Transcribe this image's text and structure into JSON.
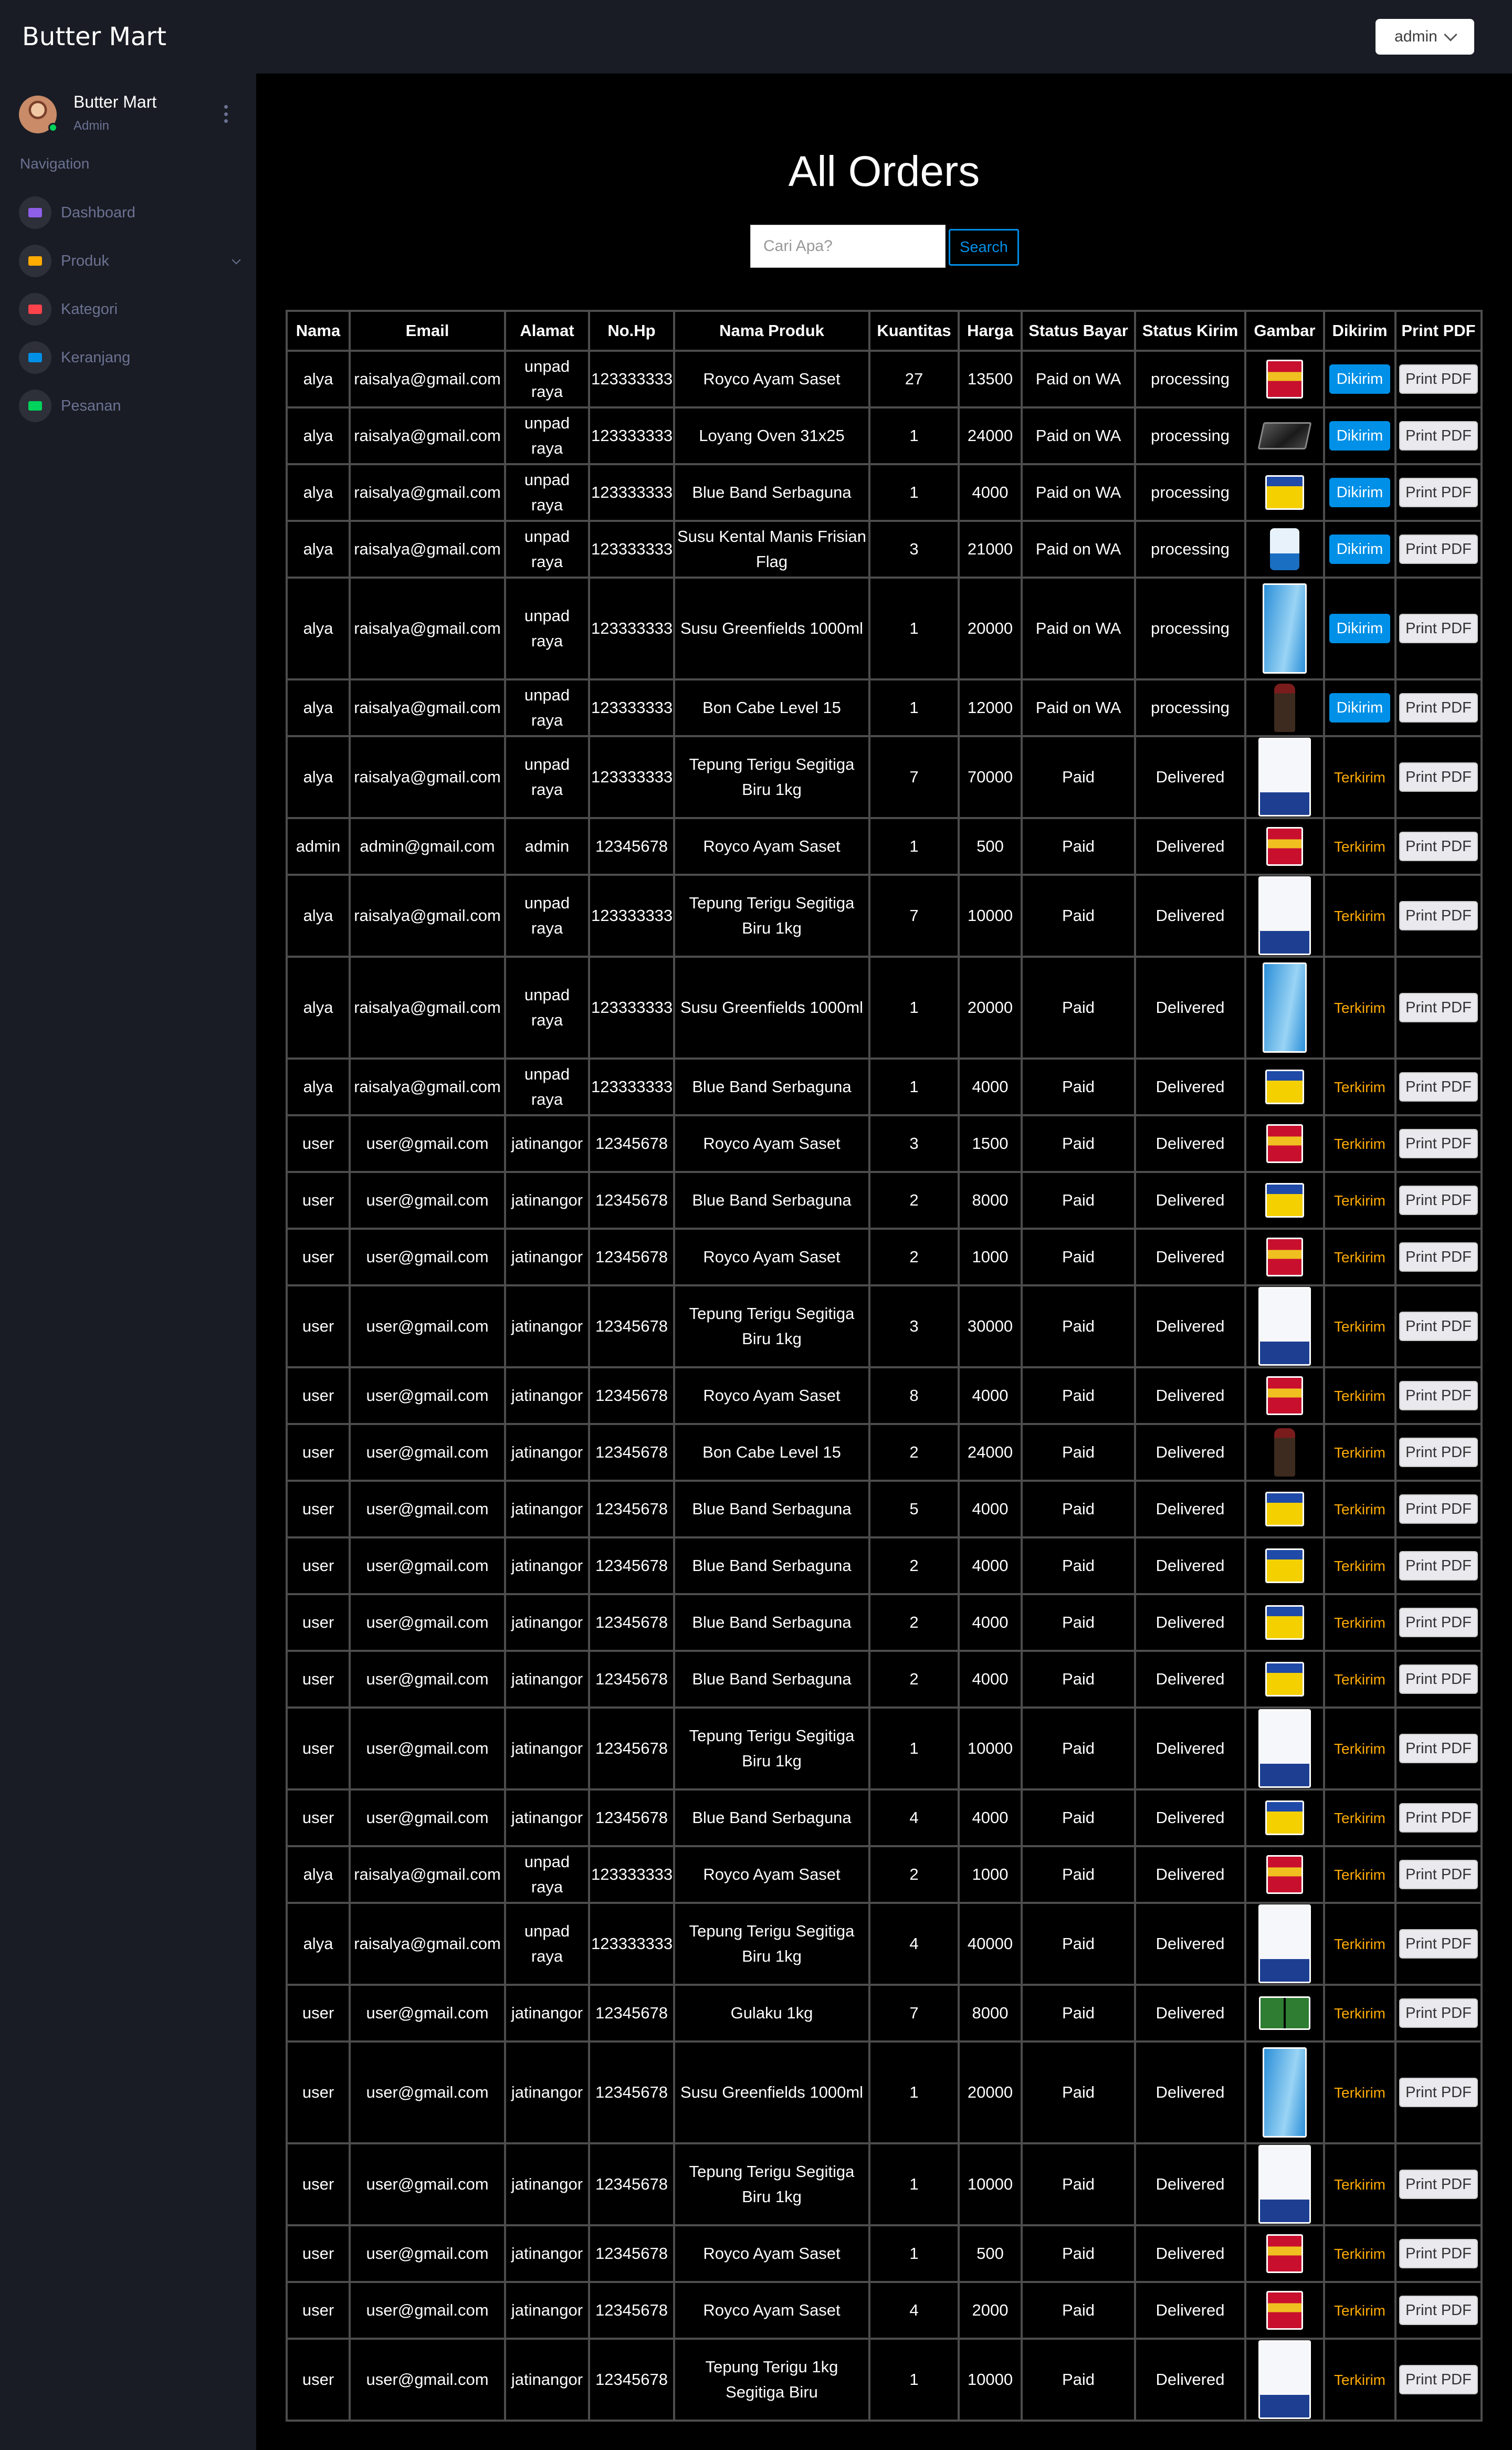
{
  "app": {
    "brand": "Butter Mart",
    "admin_dropdown": "admin"
  },
  "sidebar": {
    "profile_name": "Butter Mart",
    "profile_role": "Admin",
    "nav_heading": "Navigation",
    "items": [
      {
        "label": "Dashboard",
        "icon": "speedometer-icon",
        "color": "#8f5fe8"
      },
      {
        "label": "Produk",
        "icon": "laptop-icon",
        "color": "#ffab00"
      },
      {
        "label": "Kategori",
        "icon": "playlist-icon",
        "color": "#fc424a"
      },
      {
        "label": "Keranjang",
        "icon": "chart-bar-icon",
        "color": "#0090e7"
      },
      {
        "label": "Pesanan",
        "icon": "table-icon",
        "color": "#00d25b"
      }
    ]
  },
  "main": {
    "title": "All Orders",
    "search_placeholder": "Cari Apa?",
    "search_button": "Search",
    "columns": [
      "Nama",
      "Email",
      "Alamat",
      "No.Hp",
      "Nama Produk",
      "Kuantitas",
      "Harga",
      "Status Bayar",
      "Status Kirim",
      "Gambar",
      "Dikirim",
      "Print PDF"
    ],
    "dikirim_label": "Dikirim",
    "terkirim_label": "Terkirim",
    "print_label": "Print PDF"
  },
  "orders": [
    {
      "nama": "alya",
      "email": "raisalya@gmail.com",
      "alamat": "unpad raya",
      "hp": "123333333",
      "produk": "Royco Ayam Saset",
      "qty": "27",
      "harga": "13500",
      "bayar": "Paid on WA",
      "kirim": "processing",
      "img": "royco",
      "dikirim": true
    },
    {
      "nama": "alya",
      "email": "raisalya@gmail.com",
      "alamat": "unpad raya",
      "hp": "123333333",
      "produk": "Loyang Oven 31x25",
      "qty": "1",
      "harga": "24000",
      "bayar": "Paid on WA",
      "kirim": "processing",
      "img": "loyang",
      "dikirim": true
    },
    {
      "nama": "alya",
      "email": "raisalya@gmail.com",
      "alamat": "unpad raya",
      "hp": "123333333",
      "produk": "Blue Band Serbaguna",
      "qty": "1",
      "harga": "4000",
      "bayar": "Paid on WA",
      "kirim": "processing",
      "img": "blueband",
      "dikirim": true
    },
    {
      "nama": "alya",
      "email": "raisalya@gmail.com",
      "alamat": "unpad raya",
      "hp": "123333333",
      "produk": "Susu Kental Manis Frisian Flag",
      "qty": "3",
      "harga": "21000",
      "bayar": "Paid on WA",
      "kirim": "processing",
      "img": "frisian",
      "dikirim": true
    },
    {
      "nama": "alya",
      "email": "raisalya@gmail.com",
      "alamat": "unpad raya",
      "hp": "123333333",
      "produk": "Susu Greenfields 1000ml",
      "qty": "1",
      "harga": "20000",
      "bayar": "Paid on WA",
      "kirim": "processing",
      "img": "green",
      "dikirim": true
    },
    {
      "nama": "alya",
      "email": "raisalya@gmail.com",
      "alamat": "unpad raya",
      "hp": "123333333",
      "produk": "Bon Cabe Level 15",
      "qty": "1",
      "harga": "12000",
      "bayar": "Paid on WA",
      "kirim": "processing",
      "img": "boncabe",
      "dikirim": true
    },
    {
      "nama": "alya",
      "email": "raisalya@gmail.com",
      "alamat": "unpad raya",
      "hp": "123333333",
      "produk": "Tepung Terigu Segitiga Biru 1kg",
      "qty": "7",
      "harga": "70000",
      "bayar": "Paid",
      "kirim": "Delivered",
      "img": "tepung",
      "dikirim": false
    },
    {
      "nama": "admin",
      "email": "admin@gmail.com",
      "alamat": "admin",
      "hp": "12345678",
      "produk": "Royco Ayam Saset",
      "qty": "1",
      "harga": "500",
      "bayar": "Paid",
      "kirim": "Delivered",
      "img": "royco",
      "dikirim": false
    },
    {
      "nama": "alya",
      "email": "raisalya@gmail.com",
      "alamat": "unpad raya",
      "hp": "123333333",
      "produk": "Tepung Terigu Segitiga Biru 1kg",
      "qty": "7",
      "harga": "10000",
      "bayar": "Paid",
      "kirim": "Delivered",
      "img": "tepung",
      "dikirim": false
    },
    {
      "nama": "alya",
      "email": "raisalya@gmail.com",
      "alamat": "unpad raya",
      "hp": "123333333",
      "produk": "Susu Greenfields 1000ml",
      "qty": "1",
      "harga": "20000",
      "bayar": "Paid",
      "kirim": "Delivered",
      "img": "green",
      "dikirim": false
    },
    {
      "nama": "alya",
      "email": "raisalya@gmail.com",
      "alamat": "unpad raya",
      "hp": "123333333",
      "produk": "Blue Band Serbaguna",
      "qty": "1",
      "harga": "4000",
      "bayar": "Paid",
      "kirim": "Delivered",
      "img": "blueband",
      "dikirim": false
    },
    {
      "nama": "user",
      "email": "user@gmail.com",
      "alamat": "jatinangor",
      "hp": "12345678",
      "produk": "Royco Ayam Saset",
      "qty": "3",
      "harga": "1500",
      "bayar": "Paid",
      "kirim": "Delivered",
      "img": "royco",
      "dikirim": false
    },
    {
      "nama": "user",
      "email": "user@gmail.com",
      "alamat": "jatinangor",
      "hp": "12345678",
      "produk": "Blue Band Serbaguna",
      "qty": "2",
      "harga": "8000",
      "bayar": "Paid",
      "kirim": "Delivered",
      "img": "blueband",
      "dikirim": false
    },
    {
      "nama": "user",
      "email": "user@gmail.com",
      "alamat": "jatinangor",
      "hp": "12345678",
      "produk": "Royco Ayam Saset",
      "qty": "2",
      "harga": "1000",
      "bayar": "Paid",
      "kirim": "Delivered",
      "img": "royco",
      "dikirim": false
    },
    {
      "nama": "user",
      "email": "user@gmail.com",
      "alamat": "jatinangor",
      "hp": "12345678",
      "produk": "Tepung Terigu Segitiga Biru 1kg",
      "qty": "3",
      "harga": "30000",
      "bayar": "Paid",
      "kirim": "Delivered",
      "img": "tepung",
      "dikirim": false
    },
    {
      "nama": "user",
      "email": "user@gmail.com",
      "alamat": "jatinangor",
      "hp": "12345678",
      "produk": "Royco Ayam Saset",
      "qty": "8",
      "harga": "4000",
      "bayar": "Paid",
      "kirim": "Delivered",
      "img": "royco",
      "dikirim": false
    },
    {
      "nama": "user",
      "email": "user@gmail.com",
      "alamat": "jatinangor",
      "hp": "12345678",
      "produk": "Bon Cabe Level 15",
      "qty": "2",
      "harga": "24000",
      "bayar": "Paid",
      "kirim": "Delivered",
      "img": "boncabe",
      "dikirim": false
    },
    {
      "nama": "user",
      "email": "user@gmail.com",
      "alamat": "jatinangor",
      "hp": "12345678",
      "produk": "Blue Band Serbaguna",
      "qty": "5",
      "harga": "4000",
      "bayar": "Paid",
      "kirim": "Delivered",
      "img": "blueband",
      "dikirim": false
    },
    {
      "nama": "user",
      "email": "user@gmail.com",
      "alamat": "jatinangor",
      "hp": "12345678",
      "produk": "Blue Band Serbaguna",
      "qty": "2",
      "harga": "4000",
      "bayar": "Paid",
      "kirim": "Delivered",
      "img": "blueband",
      "dikirim": false
    },
    {
      "nama": "user",
      "email": "user@gmail.com",
      "alamat": "jatinangor",
      "hp": "12345678",
      "produk": "Blue Band Serbaguna",
      "qty": "2",
      "harga": "4000",
      "bayar": "Paid",
      "kirim": "Delivered",
      "img": "blueband",
      "dikirim": false
    },
    {
      "nama": "user",
      "email": "user@gmail.com",
      "alamat": "jatinangor",
      "hp": "12345678",
      "produk": "Blue Band Serbaguna",
      "qty": "2",
      "harga": "4000",
      "bayar": "Paid",
      "kirim": "Delivered",
      "img": "blueband",
      "dikirim": false
    },
    {
      "nama": "user",
      "email": "user@gmail.com",
      "alamat": "jatinangor",
      "hp": "12345678",
      "produk": "Tepung Terigu Segitiga Biru 1kg",
      "qty": "1",
      "harga": "10000",
      "bayar": "Paid",
      "kirim": "Delivered",
      "img": "tepung",
      "dikirim": false
    },
    {
      "nama": "user",
      "email": "user@gmail.com",
      "alamat": "jatinangor",
      "hp": "12345678",
      "produk": "Blue Band Serbaguna",
      "qty": "4",
      "harga": "4000",
      "bayar": "Paid",
      "kirim": "Delivered",
      "img": "blueband",
      "dikirim": false
    },
    {
      "nama": "alya",
      "email": "raisalya@gmail.com",
      "alamat": "unpad raya",
      "hp": "123333333",
      "produk": "Royco Ayam Saset",
      "qty": "2",
      "harga": "1000",
      "bayar": "Paid",
      "kirim": "Delivered",
      "img": "royco",
      "dikirim": false
    },
    {
      "nama": "alya",
      "email": "raisalya@gmail.com",
      "alamat": "unpad raya",
      "hp": "123333333",
      "produk": "Tepung Terigu Segitiga Biru 1kg",
      "qty": "4",
      "harga": "40000",
      "bayar": "Paid",
      "kirim": "Delivered",
      "img": "tepung",
      "dikirim": false
    },
    {
      "nama": "user",
      "email": "user@gmail.com",
      "alamat": "jatinangor",
      "hp": "12345678",
      "produk": "Gulaku 1kg",
      "qty": "7",
      "harga": "8000",
      "bayar": "Paid",
      "kirim": "Delivered",
      "img": "gulaku",
      "dikirim": false
    },
    {
      "nama": "user",
      "email": "user@gmail.com",
      "alamat": "jatinangor",
      "hp": "12345678",
      "produk": "Susu Greenfields 1000ml",
      "qty": "1",
      "harga": "20000",
      "bayar": "Paid",
      "kirim": "Delivered",
      "img": "green",
      "dikirim": false
    },
    {
      "nama": "user",
      "email": "user@gmail.com",
      "alamat": "jatinangor",
      "hp": "12345678",
      "produk": "Tepung Terigu Segitiga Biru 1kg",
      "qty": "1",
      "harga": "10000",
      "bayar": "Paid",
      "kirim": "Delivered",
      "img": "tepung",
      "dikirim": false
    },
    {
      "nama": "user",
      "email": "user@gmail.com",
      "alamat": "jatinangor",
      "hp": "12345678",
      "produk": "Royco Ayam Saset",
      "qty": "1",
      "harga": "500",
      "bayar": "Paid",
      "kirim": "Delivered",
      "img": "royco",
      "dikirim": false
    },
    {
      "nama": "user",
      "email": "user@gmail.com",
      "alamat": "jatinangor",
      "hp": "12345678",
      "produk": "Royco Ayam Saset",
      "qty": "4",
      "harga": "2000",
      "bayar": "Paid",
      "kirim": "Delivered",
      "img": "royco",
      "dikirim": false
    },
    {
      "nama": "user",
      "email": "user@gmail.com",
      "alamat": "jatinangor",
      "hp": "12345678",
      "produk": "Tepung Terigu 1kg Segitiga Biru",
      "qty": "1",
      "harga": "10000",
      "bayar": "Paid",
      "kirim": "Delivered",
      "img": "tepung",
      "dikirim": false
    }
  ]
}
